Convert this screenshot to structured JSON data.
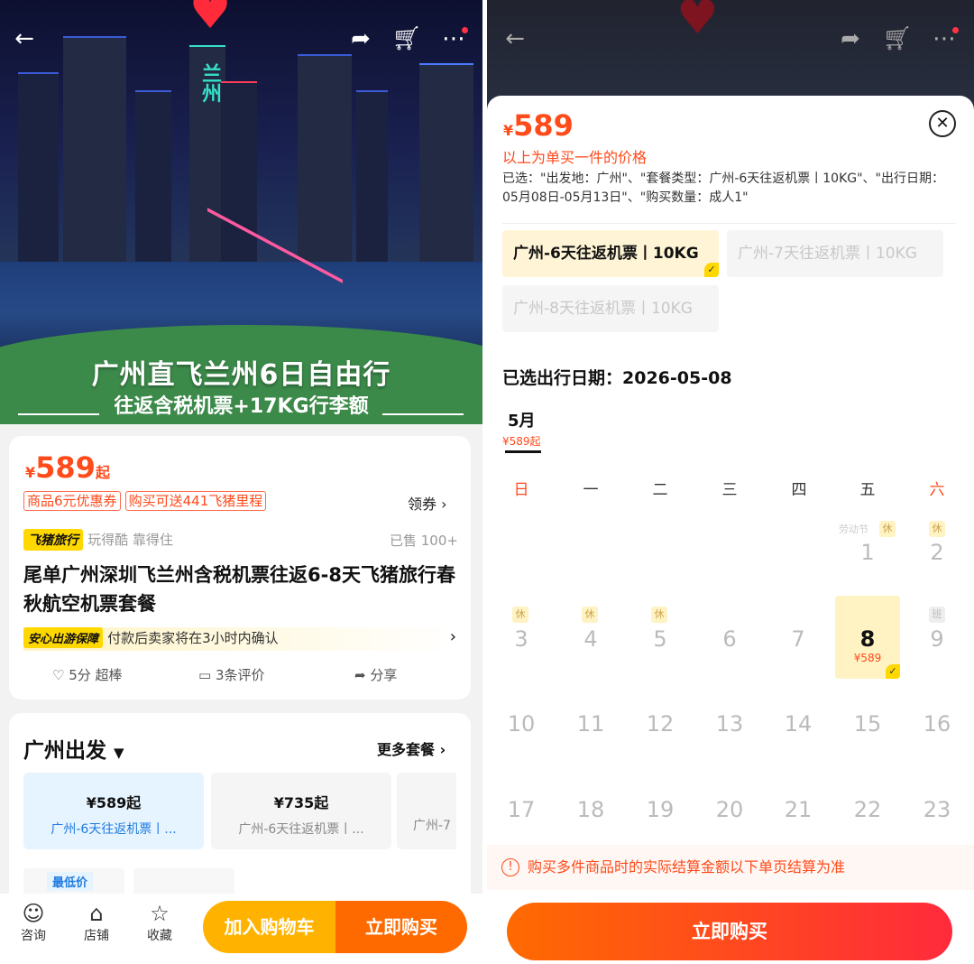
{
  "left": {
    "hero": {
      "title": "广州直飞兰州6日自由行",
      "subtitle": "往返含税机票+17KG行李额",
      "sign_text": "兰州"
    },
    "product": {
      "currency": "¥",
      "price": "589",
      "price_suffix": "起",
      "coupon_tag": "商品6元优惠券",
      "mileage_tag": "购买可送441飞猪里程",
      "coupon_link": "领券",
      "brand_badge": "飞猪旅行",
      "brand_slogan": "玩得酷 靠得住",
      "sold": "已售 100+",
      "title": "尾单广州深圳飞兰州含税机票往返6-8天飞猪旅行春秋航空机票套餐",
      "guarantee_badge": "安心出游保障",
      "guarantee_text": "付款后卖家将在3小时内确认",
      "rating": "5分 超棒",
      "reviews": "3条评价",
      "share": "分享"
    },
    "packages": {
      "departure": "广州出发",
      "more": "更多套餐",
      "items": [
        {
          "price": "¥589起",
          "name": "广州-6天往返机票丨..."
        },
        {
          "price": "¥735起",
          "name": "广州-6天往返机票丨..."
        },
        {
          "price": "",
          "name": "广州-7"
        }
      ],
      "lowest_tag": "最低价"
    },
    "bottom": {
      "consult": "咨询",
      "store": "店铺",
      "favorite": "收藏",
      "add_cart": "加入购物车",
      "buy_now": "立即购买"
    }
  },
  "right": {
    "currency": "¥",
    "price": "589",
    "price_note": "以上为单买一件的价格",
    "selected_text": "已选：\"出发地：广州\"、\"套餐类型：广州-6天往返机票丨10KG\"、\"出行日期：05月08日-05月13日\"、\"购买数量：成人1\"",
    "options": [
      "广州-6天往返机票丨10KG",
      "广州-7天往返机票丨10KG",
      "广州-8天往返机票丨10KG"
    ],
    "date_label": "已选出行日期：2026-05-08",
    "month": "5月",
    "month_price": "¥589起",
    "weekdays": [
      "日",
      "一",
      "二",
      "三",
      "四",
      "五",
      "六"
    ],
    "holiday_tag": "休",
    "work_tag": "班",
    "holiday_name": "劳动节",
    "selected_day": "8",
    "selected_price": "¥589",
    "days_row1": [
      "1",
      "2"
    ],
    "days_row2": [
      "3",
      "4",
      "5",
      "6",
      "7",
      "8",
      "9"
    ],
    "days_row3": [
      "10",
      "11",
      "12",
      "13",
      "14",
      "15",
      "16"
    ],
    "days_row4": [
      "17",
      "18",
      "19",
      "20",
      "21",
      "22",
      "23"
    ],
    "notice": "购买多件商品时的实际结算金额以下单页结算为准",
    "buy_now": "立即购买"
  },
  "colors": {
    "accent_orange": "#ff4a1a",
    "brand_yellow": "#ffd800",
    "button_orange": "#ff6a00",
    "button_yellow": "#ffb300",
    "weekend_red": "#ff4a1a"
  }
}
